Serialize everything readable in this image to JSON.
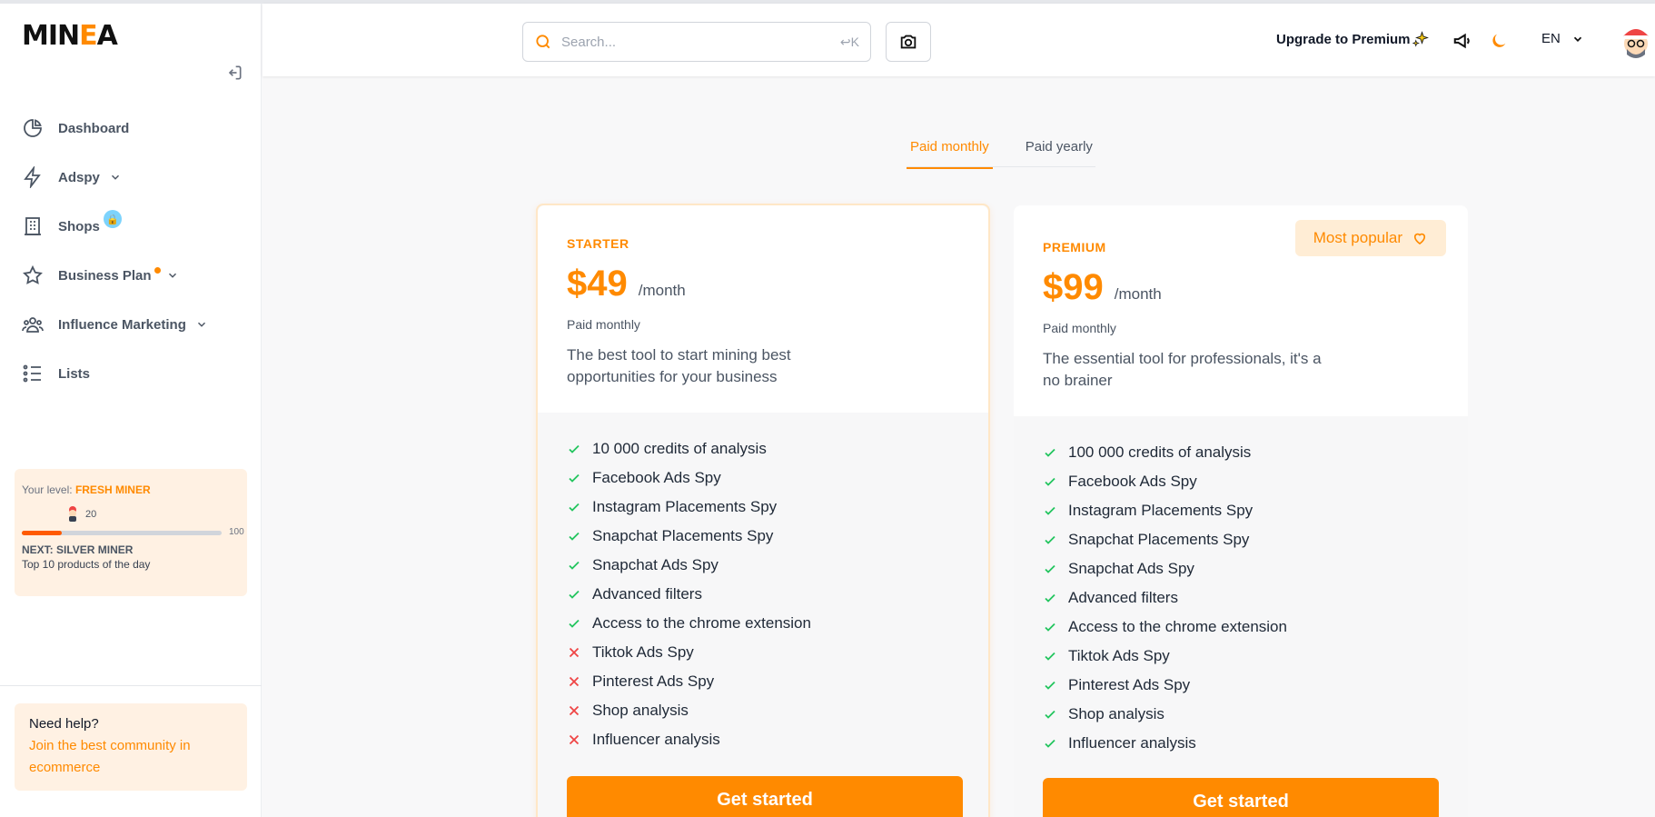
{
  "brand": {
    "logo_part1": "MIN",
    "logo_part2": "E",
    "logo_part3": "A"
  },
  "sidebar": {
    "items": [
      {
        "label": "Dashboard"
      },
      {
        "label": "Adspy"
      },
      {
        "label": "Shops"
      },
      {
        "label": "Business Plan"
      },
      {
        "label": "Influence Marketing"
      },
      {
        "label": "Lists"
      }
    ],
    "level": {
      "prefix": "Your level: ",
      "name": "FRESH MINER",
      "current": "20",
      "max": "100",
      "progress_percent": 20,
      "next": "NEXT: SILVER MINER",
      "next_desc": "Top 10 products of the day"
    },
    "help": {
      "title": "Need help?",
      "link": "Join the best community in ecommerce"
    }
  },
  "header": {
    "search_placeholder": "Search...",
    "search_shortcut": "↩K",
    "upgrade_label": "Upgrade to Premium",
    "language": "EN"
  },
  "tabs": [
    {
      "label": "Paid monthly",
      "active": true
    },
    {
      "label": "Paid yearly",
      "active": false
    }
  ],
  "plans": {
    "starter": {
      "name": "STARTER",
      "price": "$49",
      "period": "/month",
      "billing": "Paid monthly",
      "description": "The best tool to start mining best opportunities for your business",
      "features": [
        {
          "text": "10 000 credits of analysis",
          "included": true
        },
        {
          "text": "Facebook Ads Spy",
          "included": true
        },
        {
          "text": "Instagram Placements Spy",
          "included": true
        },
        {
          "text": "Snapchat Placements Spy",
          "included": true
        },
        {
          "text": "Snapchat Ads Spy",
          "included": true
        },
        {
          "text": "Advanced filters",
          "included": true
        },
        {
          "text": "Access to the chrome extension",
          "included": true
        },
        {
          "text": "Tiktok Ads Spy",
          "included": false
        },
        {
          "text": "Pinterest Ads Spy",
          "included": false
        },
        {
          "text": "Shop analysis",
          "included": false
        },
        {
          "text": "Influencer analysis",
          "included": false
        }
      ],
      "cta": "Get started"
    },
    "premium": {
      "name": "PREMIUM",
      "badge": "Most popular",
      "price": "$99",
      "period": "/month",
      "billing": "Paid monthly",
      "description": "The essential tool for professionals, it's a no brainer",
      "features": [
        {
          "text": "100 000 credits of analysis",
          "included": true
        },
        {
          "text": "Facebook Ads Spy",
          "included": true
        },
        {
          "text": "Instagram Placements Spy",
          "included": true
        },
        {
          "text": "Snapchat Placements Spy",
          "included": true
        },
        {
          "text": "Snapchat Ads Spy",
          "included": true
        },
        {
          "text": "Advanced filters",
          "included": true
        },
        {
          "text": "Access to the chrome extension",
          "included": true
        },
        {
          "text": "Tiktok Ads Spy",
          "included": true
        },
        {
          "text": "Pinterest Ads Spy",
          "included": true
        },
        {
          "text": "Shop analysis",
          "included": true
        },
        {
          "text": "Influencer analysis",
          "included": true
        }
      ],
      "cta": "Get started"
    }
  },
  "colors": {
    "accent": "#ff8a00",
    "check": "#22c55e",
    "cross": "#ef4444"
  }
}
